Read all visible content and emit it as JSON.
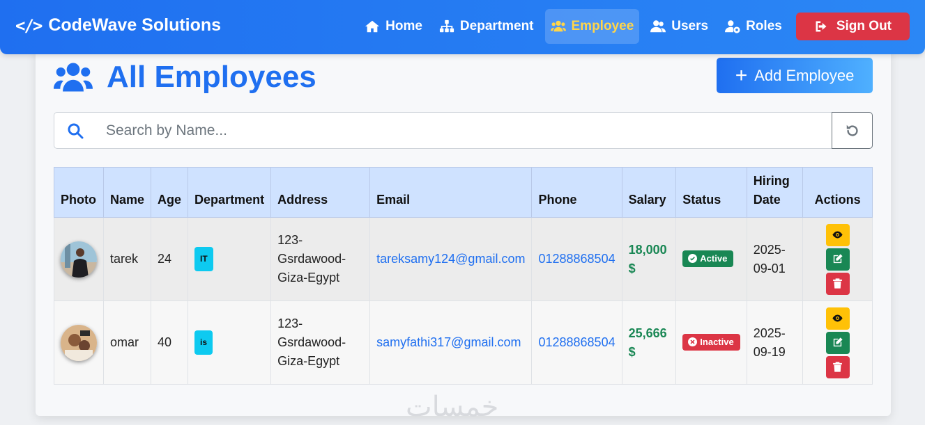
{
  "brand": {
    "name": "CodeWave Solutions",
    "icon": "code-icon"
  },
  "nav": {
    "items": [
      {
        "label": "Home",
        "icon": "home-icon",
        "active": false
      },
      {
        "label": "Department",
        "icon": "sitemap-icon",
        "active": false
      },
      {
        "label": "Employee",
        "icon": "users-icon",
        "active": true
      },
      {
        "label": "Users",
        "icon": "user-group-icon",
        "active": false
      },
      {
        "label": "Roles",
        "icon": "user-gear-icon",
        "active": false
      }
    ],
    "signout_label": "Sign Out"
  },
  "page": {
    "title": "All Employees",
    "add_label": "Add Employee",
    "search_placeholder": "Search by Name..."
  },
  "table": {
    "headers": {
      "photo": "Photo",
      "name": "Name",
      "age": "Age",
      "department": "Department",
      "address": "Address",
      "email": "Email",
      "phone": "Phone",
      "salary": "Salary",
      "status": "Status",
      "hiring_date": "Hiring Date",
      "actions": "Actions"
    },
    "rows": [
      {
        "name": "tarek",
        "age": "24",
        "department": "IT",
        "address": "123-Gsrdawood-Giza-Egypt",
        "email": "tareksamy124@gmail.com",
        "phone": "01288868504",
        "salary": "18,000 $",
        "status": "Active",
        "hiring_date": "2025-09-01"
      },
      {
        "name": "omar",
        "age": "40",
        "department": "is",
        "address": "123-Gsrdawood-Giza-Egypt",
        "email": "samyfathi317@gmail.com",
        "phone": "01288868504",
        "salary": "25,666 $",
        "status": "Inactive",
        "hiring_date": "2025-09-19"
      }
    ]
  },
  "colors": {
    "primary": "#1f6ff0",
    "active_nav": "#ffd54a",
    "danger": "#dc3545",
    "success": "#198754",
    "warning": "#ffc107",
    "info": "#0dcaf0"
  },
  "watermark": "خمسات"
}
